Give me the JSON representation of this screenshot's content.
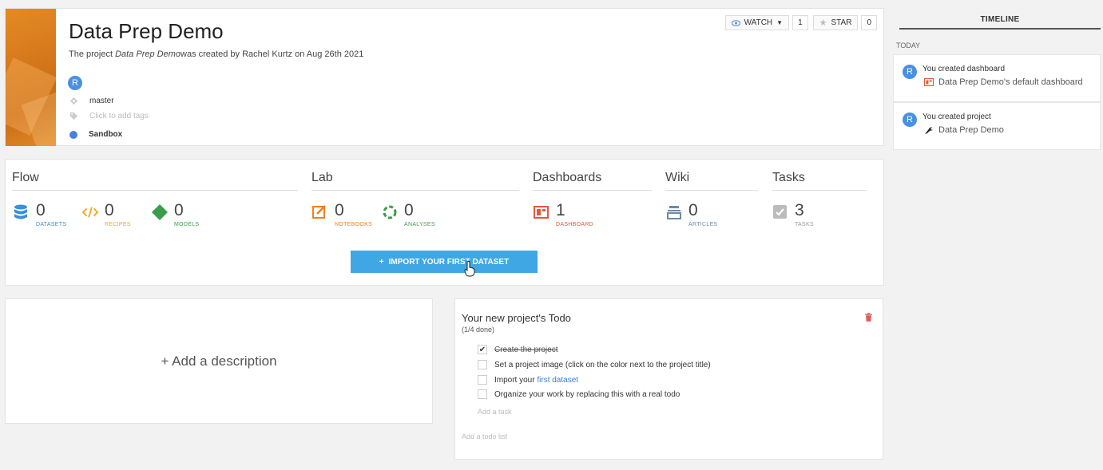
{
  "header": {
    "title": "Data Prep Demo",
    "subtitle_prefix": "The project",
    "subtitle_project": "Data Prep Demo",
    "subtitle_suffix": "was created by Rachel Kurtz on Aug 26th 2021",
    "avatar_initial": "R",
    "branch": "master",
    "tags_placeholder": "Click to add tags",
    "status": "Sandbox",
    "status_color": "#4a7fde",
    "watch_label": "WATCH",
    "watch_count": "1",
    "star_label": "STAR",
    "star_count": "0"
  },
  "timeline": {
    "title": "TIMELINE",
    "today_label": "TODAY",
    "items": [
      {
        "avatar": "R",
        "action": "You created dashboard",
        "target": "Data Prep Demo's default dashboard",
        "icon": "dashboard-icon"
      },
      {
        "avatar": "R",
        "action": "You created project",
        "target": "Data Prep Demo",
        "icon": "bird-icon"
      }
    ]
  },
  "stats": {
    "flow": {
      "title": "Flow",
      "datasets": {
        "value": "0",
        "label": "DATASETS"
      },
      "recipes": {
        "value": "0",
        "label": "RECIPES"
      },
      "models": {
        "value": "0",
        "label": "MODELS"
      }
    },
    "lab": {
      "title": "Lab",
      "notebooks": {
        "value": "0",
        "label": "NOTEBOOKS"
      },
      "analyses": {
        "value": "0",
        "label": "ANALYSES"
      }
    },
    "dashboards": {
      "title": "Dashboards",
      "dashboard": {
        "value": "1",
        "label": "DASHBOARD"
      }
    },
    "wiki": {
      "title": "Wiki",
      "articles": {
        "value": "0",
        "label": "ARTICLES"
      }
    },
    "tasks": {
      "title": "Tasks",
      "tasks": {
        "value": "3",
        "label": "TASKS"
      }
    },
    "import_button": "IMPORT YOUR FIRST DATASET"
  },
  "description": {
    "add_label": "+ Add a description"
  },
  "todo": {
    "title": "Your new project's Todo",
    "progress": "(1/4 done)",
    "items": [
      {
        "text": "Create the project",
        "done": true
      },
      {
        "text": "Set a project image (click on the color next to the project title)",
        "done": false
      },
      {
        "text_prefix": "Import your",
        "link": "first dataset",
        "done": false
      },
      {
        "text": "Organize your work by replacing this with a real todo",
        "done": false
      }
    ],
    "add_task_placeholder": "Add a task",
    "add_list_placeholder": "Add a todo list"
  },
  "colors": {
    "accent": "#3fa7e4",
    "datasets": "#3b8ed8",
    "recipes": "#f0a71e",
    "models": "#3a9d4a",
    "notebooks": "#f07f20",
    "analyses": "#3a9d4a",
    "dashboard": "#e05a3a",
    "articles": "#6b8aa8",
    "tasks": "#999999"
  }
}
